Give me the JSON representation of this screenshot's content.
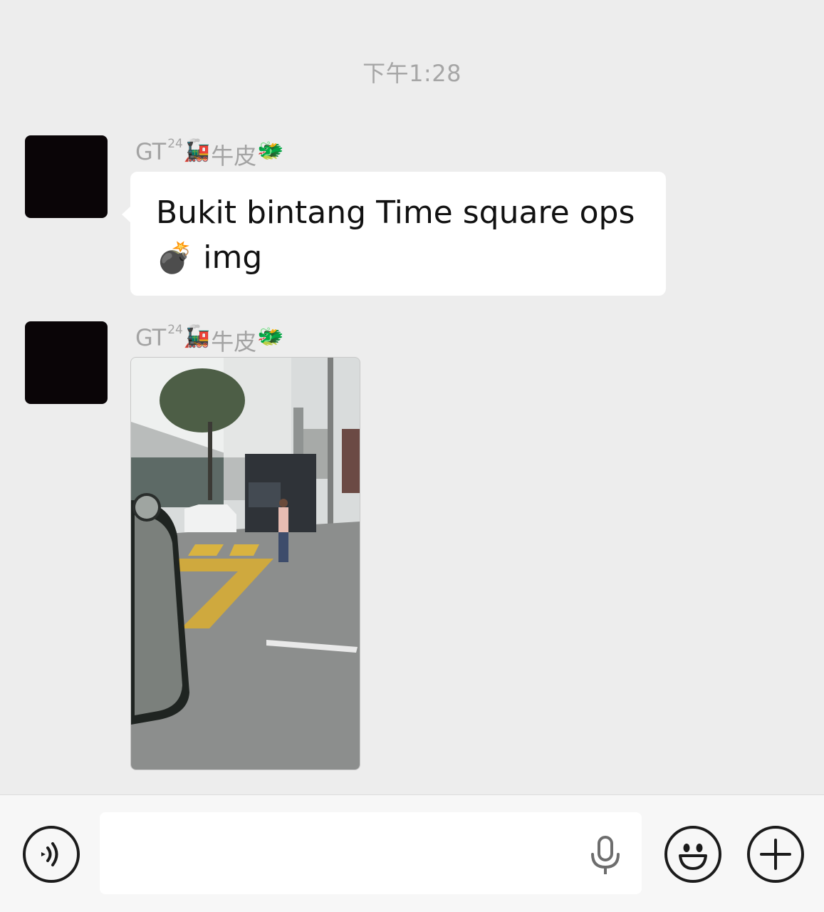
{
  "timestamp": "下午1:28",
  "sender": {
    "prefix": "GT",
    "superscript": "24",
    "emoji_1": "🚂",
    "name": "牛皮",
    "emoji_2": "🐲"
  },
  "messages": [
    {
      "type": "text",
      "line_1": "Bukit bintang Time square ops",
      "emoji": "💣",
      "line_2_text": "img"
    },
    {
      "type": "image"
    }
  ],
  "bottom_bar": {
    "voice_icon": "voice-icon",
    "input_value": "",
    "mic_icon": "microphone-icon",
    "emoji_icon": "smiley-icon",
    "more_icon": "plus-icon"
  }
}
